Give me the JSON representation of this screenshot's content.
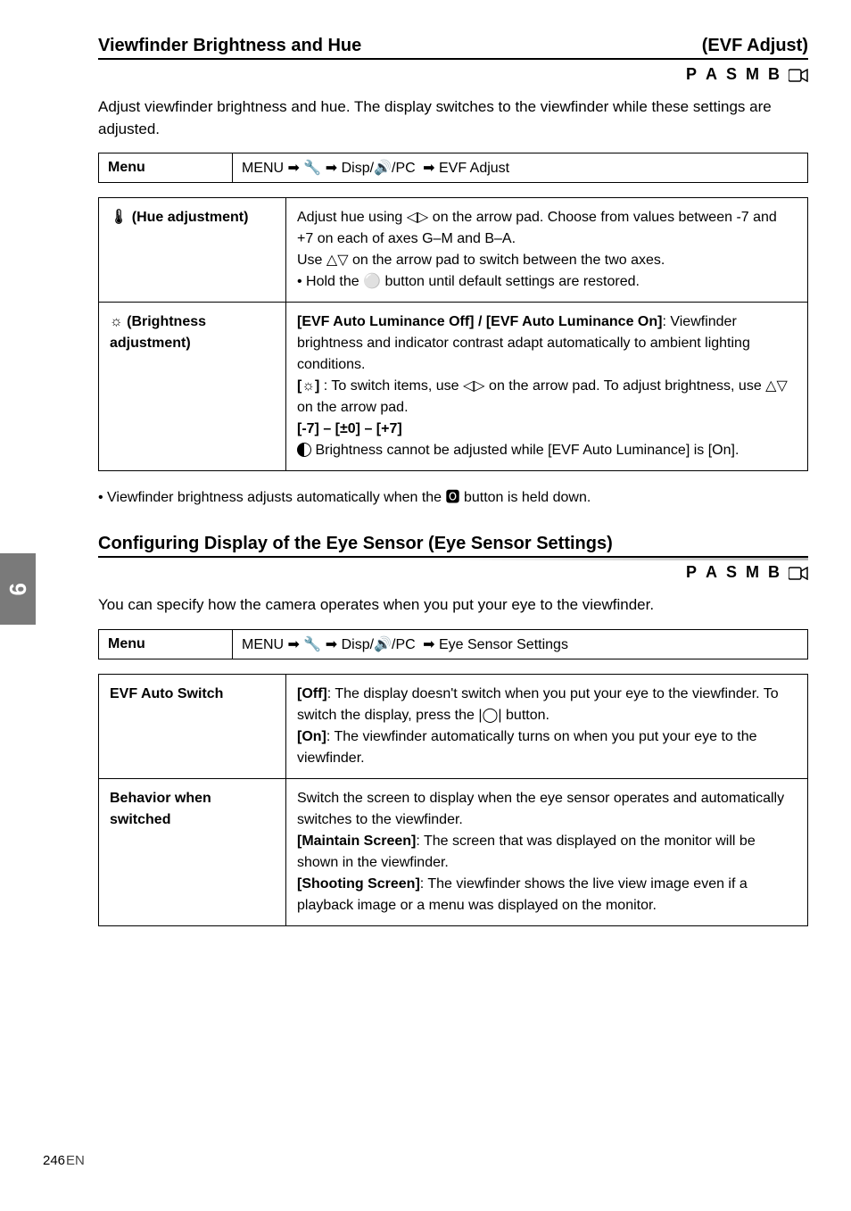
{
  "section1": {
    "title_left": "Viewfinder Brightness and Hue",
    "title_right": "(EVF Adjust)",
    "modes": [
      "P",
      "A",
      "S",
      "M",
      "B",
      "🎥"
    ],
    "intro": "Adjust viewfinder brightness and hue. The display switches to the viewfinder while these settings are adjusted.",
    "nav": {
      "left": "Menu",
      "col": "MENU ➡ 🔧 ➡ Disp/🔊/PC",
      "to": "➡ EVF Adjust"
    },
    "row1": {
      "label_icon": "🌡",
      "label_text": "(Hue adjustment)",
      "body_line1": "Adjust hue using ◁▷ on the arrow pad. Choose from values between",
      "body_line2": "-7 and +7 on each of axes G–M and B–A.",
      "body_line3": "Use △▽ on the arrow pad to switch between the two axes.",
      "body_line4": "• Hold the  ⚪  button until default settings are restored."
    },
    "row2": {
      "label_icon": "☼",
      "label_text": "(Brightness adjustment)",
      "bold1": "[EVF Auto Luminance Off] / [EVF Auto Luminance On]",
      "after_bold1": ": Viewfinder brightness and indicator contrast adapt automatically to ambient lighting conditions.",
      "line2a": "[",
      "line2a_icon": "☼",
      "line2a_close": "]",
      "line2b": ": To switch items, use ◁▷ on the arrow pad. To adjust brightness, use △▽ on the arrow pad.",
      "vals": "[-7] – [±0] – [+7]",
      "footnote_icon": "◐",
      "footnote": "Brightness cannot be adjusted while [EVF Auto Luminance] is [On]."
    },
    "note": "• Viewfinder brightness adjusts automatically when the 🅾 button is held down."
  },
  "section2": {
    "title": "Configuring Display of the Eye Sensor (Eye Sensor Settings)",
    "modes": [
      "P",
      "A",
      "S",
      "M",
      "B",
      "🎥"
    ],
    "intro": "You can specify how the camera operates when you put your eye to the viewfinder.",
    "nav": {
      "left": "Menu",
      "col": "MENU ➡ 🔧 ➡ Disp/🔊/PC",
      "to": "➡ Eye Sensor Settings"
    },
    "row1": {
      "label": "EVF Auto Switch",
      "bold_off": "[Off]",
      "after_off": ": The display doesn't switch when you put your eye to the viewfinder. To switch the display, press the |◯| button.",
      "bold_on": "[On]",
      "after_on": ": The viewfinder automatically turns on when you put your eye to the viewfinder."
    },
    "row2": {
      "label": "Behavior when switched",
      "lead": "Switch the screen to display when the eye sensor operates and automatically switches to the viewfinder.",
      "bold_maintain": "[Maintain Screen]",
      "after_maintain": ": The screen that was displayed on the monitor will be shown in the viewfinder.",
      "bold_shoot": "[Shooting Screen]",
      "after_shoot": ": The viewfinder shows the live view image even if a playback image or a menu was displayed on the monitor."
    }
  },
  "page": {
    "num": "246",
    "label": "EN"
  },
  "side_tab": "6"
}
